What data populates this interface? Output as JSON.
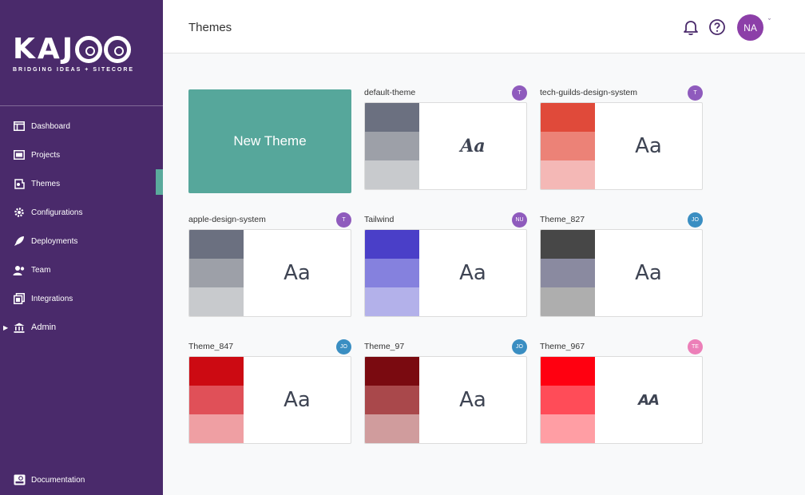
{
  "logo": {
    "word": [
      "K",
      "A",
      "J"
    ],
    "tagline": "BRIDGING IDEAS + SITECORE"
  },
  "nav": [
    {
      "label": "Dashboard",
      "icon": "dashboard-icon"
    },
    {
      "label": "Projects",
      "icon": "projects-icon"
    },
    {
      "label": "Themes",
      "icon": "themes-icon",
      "active": true
    },
    {
      "label": "Configurations",
      "icon": "gear-icon"
    },
    {
      "label": "Deployments",
      "icon": "rocket-icon"
    },
    {
      "label": "Team",
      "icon": "team-icon"
    },
    {
      "label": "Integrations",
      "icon": "integrations-icon"
    },
    {
      "label": "Admin",
      "icon": "bank-icon",
      "expandable": true
    }
  ],
  "documentation": {
    "label": "Documentation"
  },
  "header": {
    "title": "Themes",
    "avatar_initials": "NA"
  },
  "new_theme_label": "New Theme",
  "themes": [
    {
      "name": "default-theme",
      "badge": "T",
      "badge_color": "#8f5bbd",
      "colors": [
        "#6b7080",
        "#9da0a8",
        "#c8cacd"
      ],
      "preview": "Aa",
      "style": "script"
    },
    {
      "name": "tech-guilds-design-system",
      "badge": "T",
      "badge_color": "#8f5bbd",
      "colors": [
        "#e04a3a",
        "#ec8277",
        "#f4b8b6"
      ],
      "preview": "Aa",
      "style": ""
    },
    {
      "name": "apple-design-system",
      "badge": "T",
      "badge_color": "#8f5bbd",
      "colors": [
        "#6b7080",
        "#9da0a8",
        "#c8cacd"
      ],
      "preview": "Aa",
      "style": ""
    },
    {
      "name": "Tailwind",
      "badge": "NU",
      "badge_color": "#8f5bbd",
      "colors": [
        "#4a3fc8",
        "#8581de",
        "#b3b1ea"
      ],
      "preview": "Aa",
      "style": ""
    },
    {
      "name": "Theme_827",
      "badge": "JO",
      "badge_color": "#3a8ec2",
      "colors": [
        "#474747",
        "#8a8aa0",
        "#aeaeae"
      ],
      "preview": "Aa",
      "style": ""
    },
    {
      "name": "Theme_847",
      "badge": "JO",
      "badge_color": "#3a8ec2",
      "colors": [
        "#cc0a12",
        "#e05058",
        "#ef9fa3"
      ],
      "preview": "Aa",
      "style": ""
    },
    {
      "name": "Theme_97",
      "badge": "JO",
      "badge_color": "#3a8ec2",
      "colors": [
        "#7a0a10",
        "#a9484b",
        "#d09c9d"
      ],
      "preview": "Aa",
      "style": ""
    },
    {
      "name": "Theme_967",
      "badge": "TE",
      "badge_color": "#ec7fb8",
      "colors": [
        "#ff0010",
        "#ff4c58",
        "#ff9ea4"
      ],
      "preview": "AA",
      "style": "heavy"
    }
  ]
}
